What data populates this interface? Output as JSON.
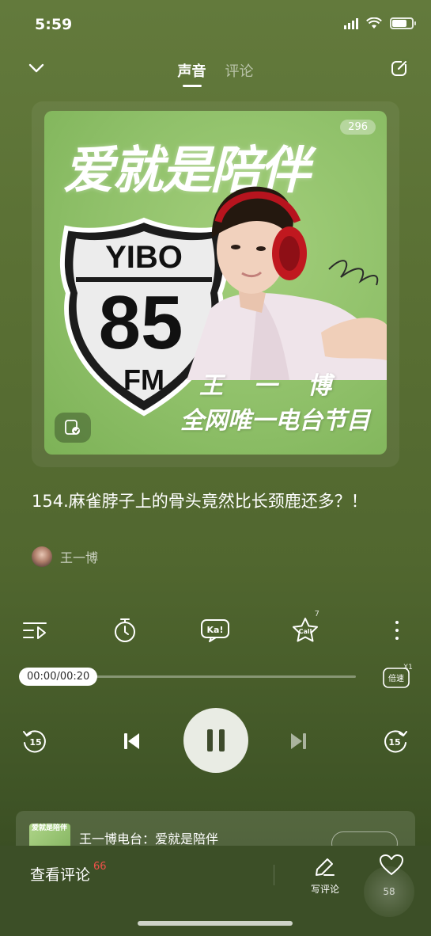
{
  "status_bar": {
    "time": "5:59"
  },
  "header": {
    "tabs": [
      {
        "label": "声音",
        "active": true
      },
      {
        "label": "评论",
        "active": false
      }
    ]
  },
  "cover": {
    "title": "爱就是陪伴",
    "count": "296",
    "shield_top": "YIBO",
    "shield_number": "85",
    "shield_bottom": "FM",
    "name": "王 一 博",
    "subtitle": "全网唯一电台节目"
  },
  "episode": {
    "title": "154.麻雀脖子上的骨头竟然比长颈鹿还多？！",
    "author": "王一博"
  },
  "actions": {
    "playlist_icon": "playlist-icon",
    "timer_icon": "timer-icon",
    "karaoke_label": "Ka!",
    "call_label": "Call",
    "call_count": "7",
    "more_icon": "more-icon"
  },
  "progress": {
    "time": "00:00/00:20",
    "fraction": 0.0,
    "speed_label": "倍速",
    "speed_badge": "X1"
  },
  "playback": {
    "rewind_label": "15",
    "forward_label": "15"
  },
  "mini_card": {
    "thumb_text": "爱就是陪伴",
    "text": "王一博电台：爱就是陪伴"
  },
  "bottom_bar": {
    "view_comments": "查看评论",
    "comment_count": "66",
    "write_comment": "写评论",
    "like_count": "58"
  },
  "colors": {
    "accent_red": "#f0504a",
    "cover_green": "#8fc069",
    "background": "#5a7034"
  }
}
